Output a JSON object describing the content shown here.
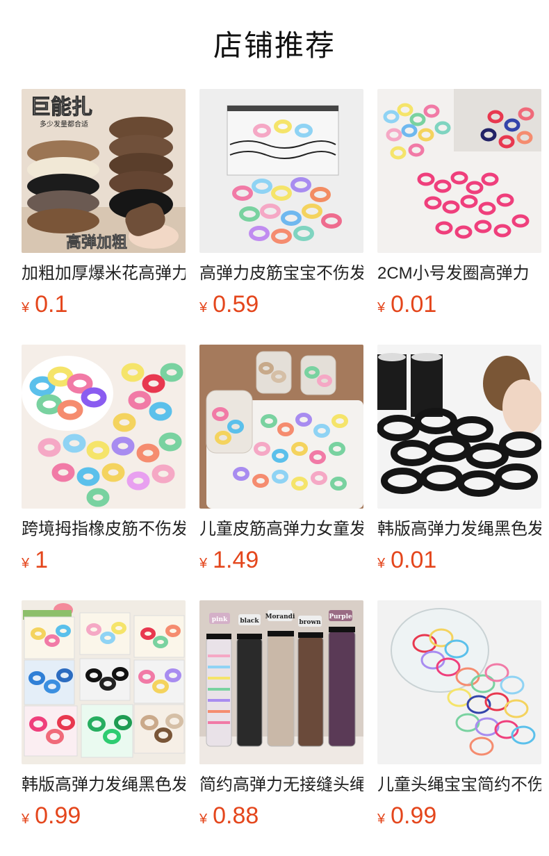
{
  "page_title": "店铺推荐",
  "currency_symbol": "¥",
  "colors": {
    "price": "#e4461c",
    "text": "#222222",
    "background": "#ffffff"
  },
  "products": [
    {
      "name": "加粗加厚爆米花高弹力",
      "price": "0.1",
      "overlay_top": "巨能扎",
      "overlay_sub": "多少发量都合适",
      "overlay_bottom": "高弹加粗"
    },
    {
      "name": "高弹力皮筋宝宝不伤发",
      "price": "0.59"
    },
    {
      "name": "2CM小号发圈高弹力",
      "price": "0.01"
    },
    {
      "name": "跨境拇指橡皮筋不伤发",
      "price": "1"
    },
    {
      "name": "儿童皮筋高弹力女童发",
      "price": "1.49"
    },
    {
      "name": "韩版高弹力发绳黑色发",
      "price": "0.01"
    },
    {
      "name": "韩版高弹力发绳黑色发",
      "price": "0.99"
    },
    {
      "name": "简约高弹力无接缝头绳",
      "price": "0.88",
      "tube_labels": [
        "pink",
        "black",
        "Morandi",
        "brown",
        "Purple"
      ]
    },
    {
      "name": "儿童头绳宝宝简约不伤",
      "price": "0.99"
    }
  ]
}
